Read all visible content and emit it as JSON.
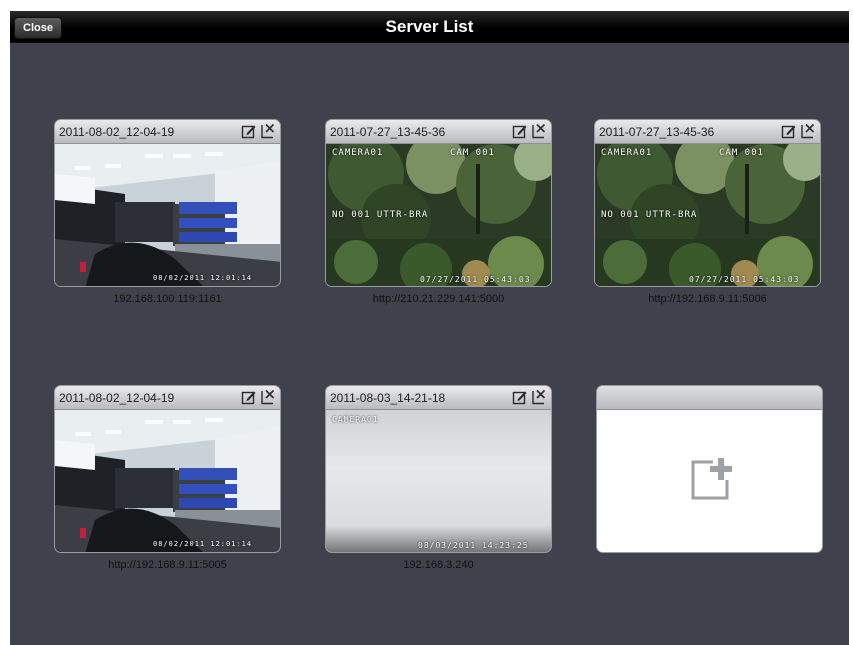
{
  "nav": {
    "title": "Server List",
    "close_label": "Close"
  },
  "servers": [
    {
      "title": "2011-08-02_12-04-19",
      "address": "192.168.100.119:1161",
      "overlay_bottom": "08/02/2011 12:01:14"
    },
    {
      "title": "2011-07-27_13-45-36",
      "address": "http://210.21.229.141:5000",
      "overlay_top_left": "CAMERA01",
      "overlay_top_right": "CAM 001",
      "overlay_mid": "NO 001 UTTR-BRA",
      "overlay_bottom": "07/27/2011 05:43:03"
    },
    {
      "title": "2011-07-27_13-45-36",
      "address": "http://192.168.9.11:5006",
      "overlay_top_left": "CAMERA01",
      "overlay_top_right": "CAM 001",
      "overlay_mid": "NO 001 UTTR-BRA",
      "overlay_bottom": "07/27/2011 05:43:03"
    },
    {
      "title": "2011-08-02_12-04-19",
      "address": "http://192.168.9.11:5005",
      "overlay_bottom": "08/02/2011 12:01:14"
    },
    {
      "title": "2011-08-03_14-21-18",
      "address": "192.168.3.240",
      "overlay_top_left": "CAMERA01",
      "overlay_bottom": "08/03/2011 14:23:25"
    }
  ],
  "icons": {
    "edit": "edit-icon",
    "delete": "delete-icon",
    "add": "add-server-icon"
  },
  "colors": {
    "background": "#3f424c",
    "navbar": "#000000",
    "card_header": "#c9cbcf"
  }
}
